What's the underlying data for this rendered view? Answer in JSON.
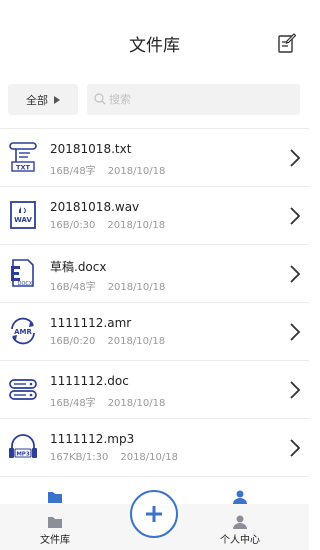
{
  "header": {
    "title": "文件库"
  },
  "filter": {
    "label": "全部"
  },
  "search": {
    "placeholder": "搜索",
    "value": ""
  },
  "files": [
    {
      "name": "20181018.txt",
      "meta": "16B/48字",
      "date": "2018/10/18",
      "type": "txt"
    },
    {
      "name": "20181018.wav",
      "meta": "16B/0:30",
      "date": "2018/10/18",
      "type": "wav"
    },
    {
      "name": "草稿.docx",
      "meta": "16B/48字",
      "date": "2018/10/18",
      "type": "docx"
    },
    {
      "name": "1111112.amr",
      "meta": "16B/0:20",
      "date": "2018/10/18",
      "type": "amr"
    },
    {
      "name": "1111112.doc",
      "meta": "16B/48字",
      "date": "2018/10/18",
      "type": "doc"
    },
    {
      "name": "1111112.mp3",
      "meta": "167KB/1:30",
      "date": "2018/10/18",
      "type": "mp3"
    }
  ],
  "icons": {
    "txt": "TXT",
    "wav": "WAV",
    "docx": "DOCX",
    "amr": "AMR",
    "mp3": "MP3"
  },
  "tabbar": {
    "tabs": [
      {
        "label": "文件库",
        "icon": "folder-icon"
      },
      {
        "label": "个人中心",
        "icon": "user-icon"
      }
    ],
    "add_icon": "plus-icon"
  },
  "colors": {
    "accent": "#3a73c9",
    "icon": "#2d3e99",
    "divider": "#ececec",
    "meta": "#999999"
  }
}
